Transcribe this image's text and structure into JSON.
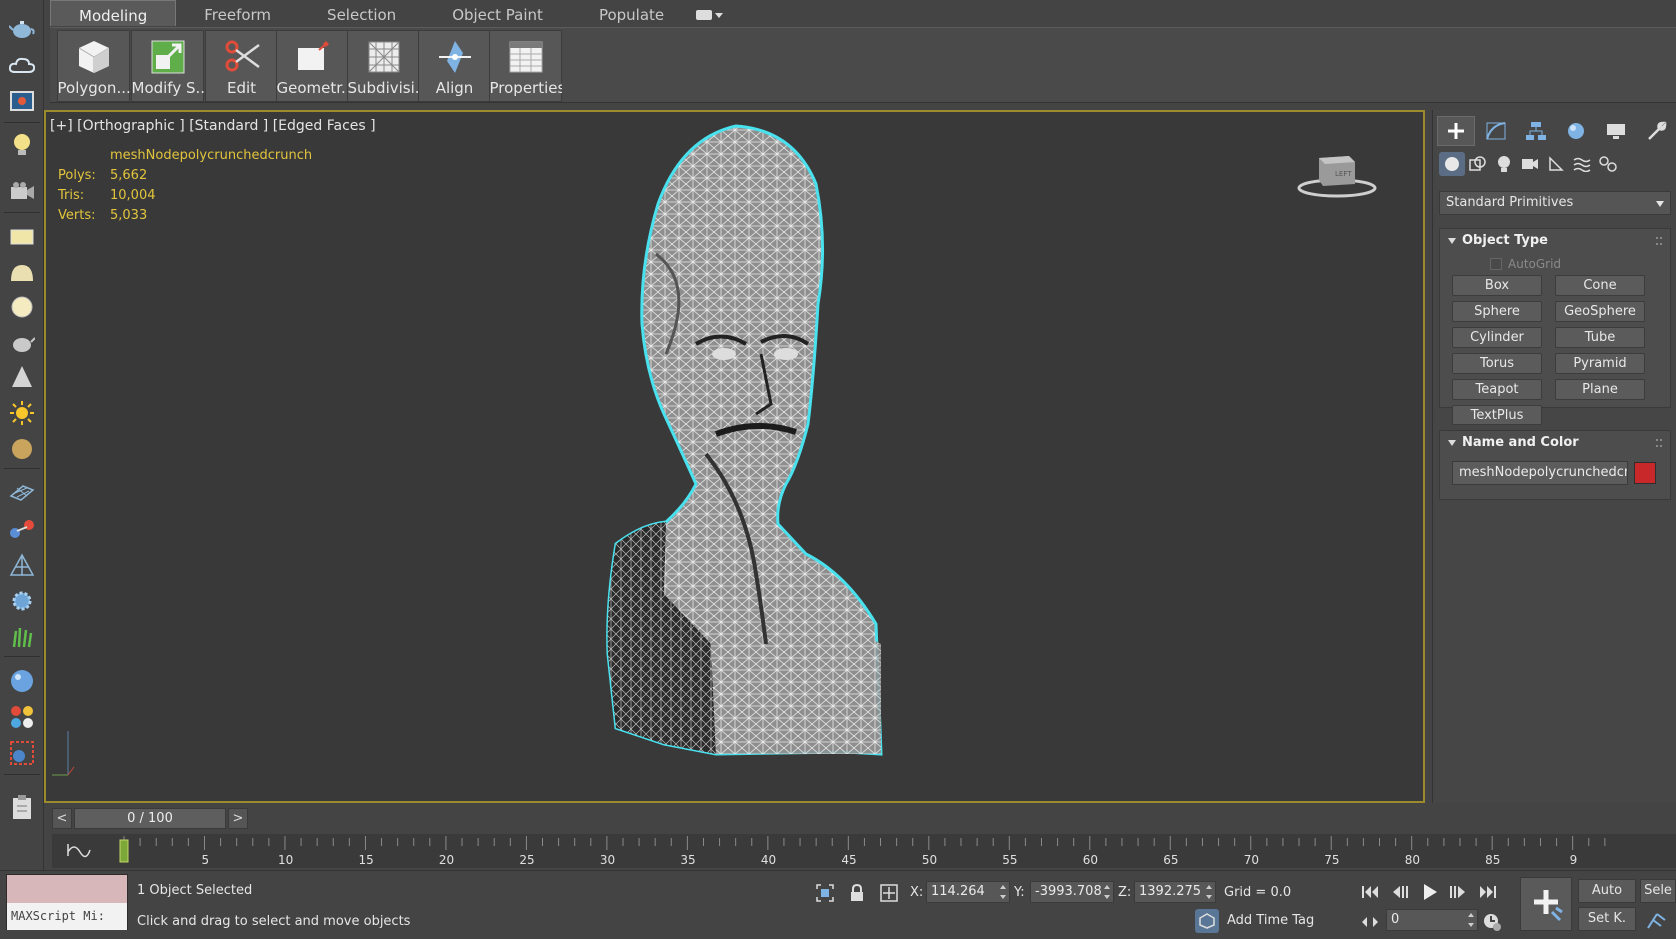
{
  "ribbon": {
    "tabs": [
      "Modeling",
      "Freeform",
      "Selection",
      "Object Paint",
      "Populate"
    ],
    "buttons": [
      "Polygon...",
      "Modify S...",
      "Edit",
      "Geometr...",
      "Subdivisi...",
      "Align",
      "Properties"
    ]
  },
  "viewport": {
    "label": "[+] [Orthographic ] [Standard ] [Edged Faces ]",
    "object_name": "meshNodepolycrunchedcrunch",
    "stats": [
      {
        "key": "Polys:",
        "value": "5,662"
      },
      {
        "key": "Tris:",
        "value": "10,004"
      },
      {
        "key": "Verts:",
        "value": "5,033"
      }
    ],
    "viewcube_face": "LEFT"
  },
  "command_panel": {
    "category": "Standard Primitives",
    "object_type": {
      "title": "Object Type",
      "autogrid": "AutoGrid",
      "buttons": [
        "Box",
        "Cone",
        "Sphere",
        "GeoSphere",
        "Cylinder",
        "Tube",
        "Torus",
        "Pyramid",
        "Teapot",
        "Plane",
        "TextPlus"
      ]
    },
    "name_color": {
      "title": "Name and Color",
      "name": "meshNodepolycrunchedcrunch",
      "color": "#c8282a"
    }
  },
  "time": {
    "slider": "0 / 100",
    "prev": "<",
    "next": ">",
    "ticks": [
      "5",
      "10",
      "15",
      "20",
      "25",
      "30",
      "35",
      "40",
      "45",
      "50",
      "55",
      "60",
      "65",
      "70",
      "75",
      "80",
      "85",
      "9"
    ]
  },
  "status": {
    "maxscript": "MAXScript Mi:",
    "selected": "1 Object Selected",
    "prompt": "Click and drag to select and move objects",
    "x_label": "X:",
    "x": "114.264",
    "y_label": "Y:",
    "y": "-3993.708",
    "z_label": "Z:",
    "z": "1392.275",
    "grid": "Grid = 0.0",
    "add_time_tag": "Add Time Tag",
    "frame": "0",
    "auto": "Auto",
    "set_key": "Set K.",
    "selected_btn": "Sele"
  }
}
